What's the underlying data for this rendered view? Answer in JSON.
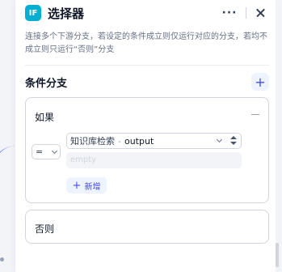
{
  "header": {
    "app_icon_text": "IF",
    "title": "选择器",
    "more_icon": "more-horizontal-icon",
    "close_icon": "close-icon"
  },
  "description": "连接多个下游分支，若设定的条件成立则仅运行对应的分支，若均不成立则只运行“否则”分支",
  "section": {
    "title": "条件分支",
    "add_icon": "plus-icon"
  },
  "if_card": {
    "label": "如果",
    "operator": "=",
    "variable_node": "知识库检索",
    "variable_separator": "-",
    "variable_field": "output",
    "value_placeholder": "empty",
    "add_label": "新增"
  },
  "else_card": {
    "label": "否则"
  },
  "colors": {
    "accent": "#444ce7",
    "accent_bg": "#eef4ff",
    "app_icon_bg": "#06aed4"
  }
}
